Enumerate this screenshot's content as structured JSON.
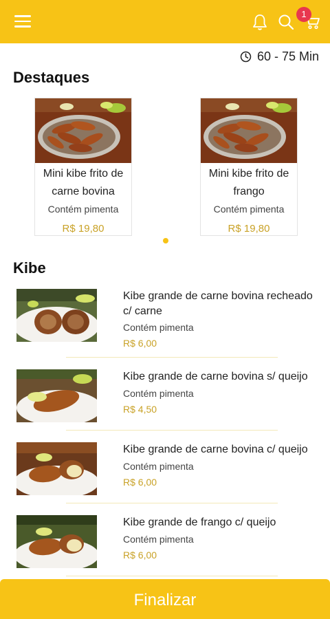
{
  "header": {
    "cart_count": "1",
    "accent_color": "#f7c316",
    "icons": [
      "menu-icon",
      "bell-icon",
      "search-icon",
      "cart-icon"
    ]
  },
  "delivery": {
    "eta": "60 - 75 Min"
  },
  "highlights": {
    "title": "Destaques",
    "items": [
      {
        "name": "Mini kibe frito de carne bovina",
        "note": "Contém pimenta",
        "price": "R$ 19,80"
      },
      {
        "name": "Mini kibe frito de frango",
        "note": "Contém pimenta",
        "price": "R$ 19,80"
      }
    ]
  },
  "kibe": {
    "title": "Kibe",
    "items": [
      {
        "name": "Kibe grande de carne bovina recheado c/ carne",
        "note": "Contém pimenta",
        "price": "R$ 6,00"
      },
      {
        "name": "Kibe grande de carne bovina s/ queijo",
        "note": "Contém pimenta",
        "price": "R$ 4,50"
      },
      {
        "name": "Kibe grande de carne bovina c/ queijo",
        "note": "Contém pimenta",
        "price": "R$ 6,00"
      },
      {
        "name": "Kibe grande de frango c/ queijo",
        "note": "Contém pimenta",
        "price": "R$ 6,00"
      }
    ]
  },
  "footer": {
    "finalize_label": "Finalizar"
  }
}
